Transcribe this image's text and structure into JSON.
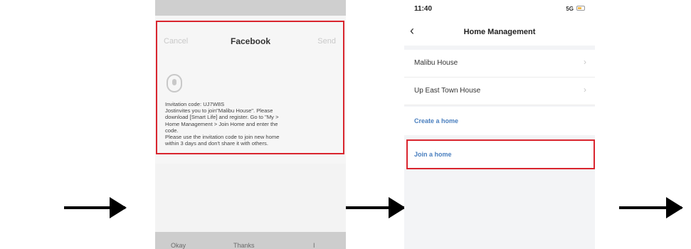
{
  "share_screen": {
    "status_time": "",
    "status_icons": "",
    "cancel_label": "Cancel",
    "title": "Facebook",
    "send_label": "Send",
    "message_lines": [
      "Invitation code: UJ7W8S",
      "Jostinvites you to join\"Malibu House\". Please",
      "download [Smart Life] and register. Go to \"My >",
      "Home Management > Join Home and enter the",
      "code.",
      "Please use the invitation code to join new home",
      "within 3 days and don't share it with others."
    ],
    "keyboard": {
      "left": "Okay",
      "middle": "Thanks",
      "right": "I"
    }
  },
  "home_screen": {
    "status_time": "11:40",
    "status_signal": "5G",
    "title": "Home Management",
    "homes": [
      {
        "label": "Malibu House"
      },
      {
        "label": "Up East Town House"
      }
    ],
    "create_label": "Create a home",
    "join_label": "Join a home"
  },
  "colors": {
    "highlight": "#d9252e",
    "link": "#4a7fbf"
  }
}
